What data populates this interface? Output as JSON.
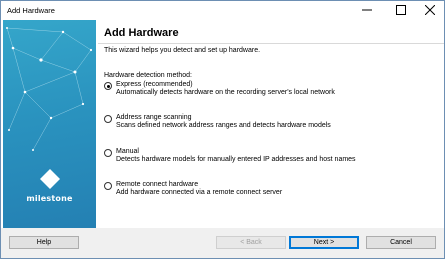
{
  "window": {
    "title": "Add Hardware"
  },
  "side_panel": {
    "logo_text": "milestone",
    "colors": {
      "top": "#35a6ca",
      "bottom": "#2480b3"
    }
  },
  "main": {
    "heading": "Add Hardware",
    "intro": "This wizard helps you detect and set up hardware.",
    "method_label": "Hardware detection method:",
    "options": [
      {
        "title": "Express (recommended)",
        "description": "Automatically detects hardware on the recording server's local network",
        "selected": true
      },
      {
        "title": "Address range scanning",
        "description": "Scans defined network address ranges and detects hardware models",
        "selected": false
      },
      {
        "title": "Manual",
        "description": "Detects hardware models for manually entered IP addresses and host names",
        "selected": false
      },
      {
        "title": "Remote connect hardware",
        "description": "Add hardware connected via a remote connect server",
        "selected": false
      }
    ]
  },
  "footer": {
    "help": "Help",
    "back": "< Back",
    "next": "Next >",
    "cancel": "Cancel"
  },
  "icons": {
    "minimize": "minimize-icon",
    "maximize": "maximize-icon",
    "close": "close-icon"
  }
}
